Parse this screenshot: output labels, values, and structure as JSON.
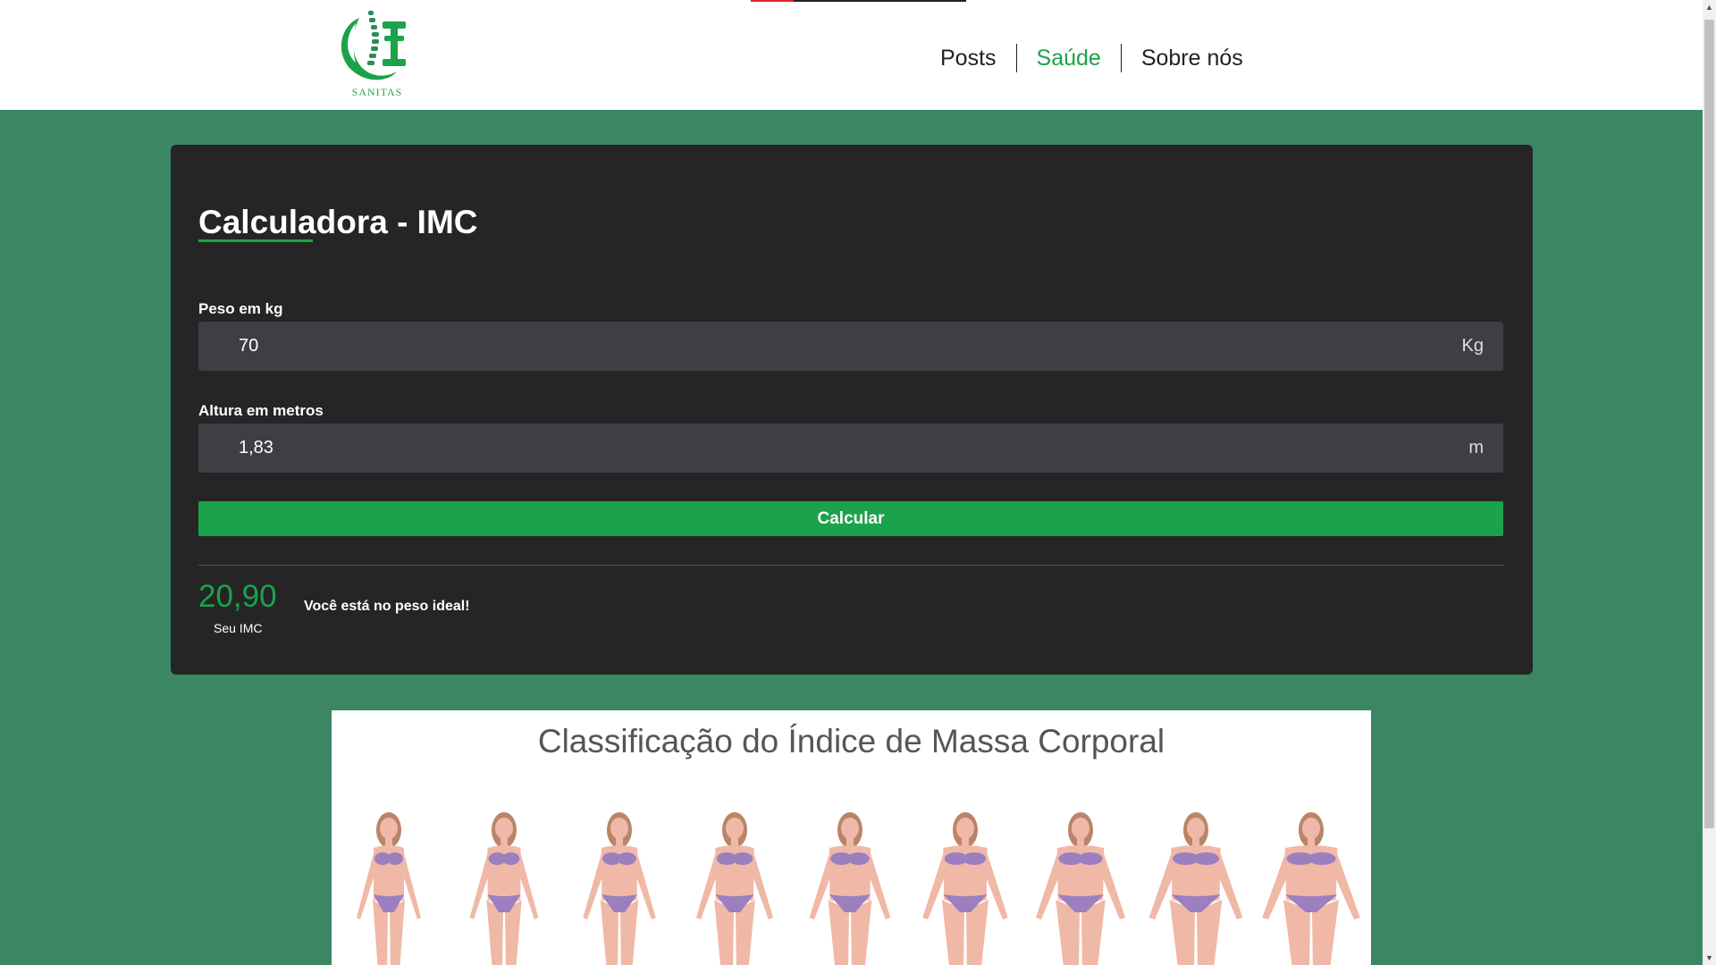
{
  "header": {
    "logo_text": "SANITAS",
    "nav": [
      {
        "label": "Posts",
        "active": false
      },
      {
        "label": "Saúde",
        "active": true
      },
      {
        "label": "Sobre nós",
        "active": false
      }
    ]
  },
  "calculator": {
    "title": "Calculadora - IMC",
    "weight": {
      "label": "Peso em kg",
      "value": "70",
      "unit": "Kg"
    },
    "height": {
      "label": "Altura em metros",
      "value": "1,83",
      "unit": "m"
    },
    "button_label": "Calcular",
    "result": {
      "value": "20,90",
      "caption": "Seu IMC",
      "message": "Você está no peso ideal!"
    }
  },
  "classification": {
    "title": "Classificação do Índice de Massa Corporal",
    "figure_count": 9
  },
  "colors": {
    "background": "#3b8764",
    "accent": "#1aa34a",
    "card": "#252525",
    "input": "#3e3f44",
    "figure_skin": "#f0b8a6",
    "figure_outfit": "#9b7fbe",
    "figure_hair": "#b98568"
  }
}
